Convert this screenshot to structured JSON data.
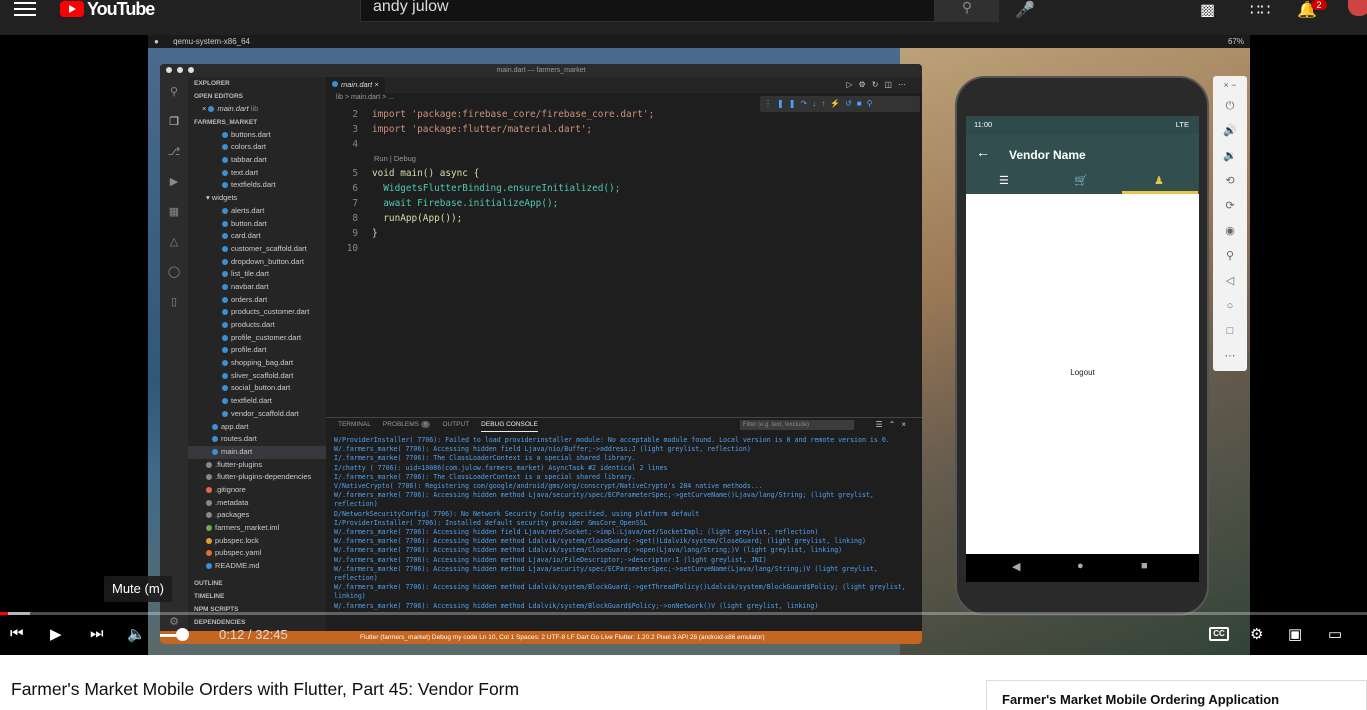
{
  "youtube": {
    "logo_text": "YouTube",
    "search_value": "andy julow",
    "notif_count": "2"
  },
  "mac": {
    "app_name": "qemu-system-x86_64",
    "battery": "67%"
  },
  "vscode": {
    "title": "main.dart — farmers_market",
    "explorer_label": "EXPLORER",
    "open_editors": "OPEN EDITORS",
    "open_file": "main.dart",
    "open_file_dir": "lib",
    "project": "FARMERS_MARKET",
    "files": [
      "buttons.dart",
      "colors.dart",
      "tabbar.dart",
      "text.dart",
      "textfields.dart"
    ],
    "widgets_folder": "widgets",
    "widget_files": [
      "alerts.dart",
      "button.dart",
      "card.dart",
      "customer_scaffold.dart",
      "dropdown_button.dart",
      "list_tile.dart",
      "navbar.dart",
      "orders.dart",
      "products_customer.dart",
      "products.dart",
      "profile_customer.dart",
      "profile.dart",
      "shopping_bag.dart",
      "sliver_scaffold.dart",
      "social_button.dart",
      "textfield.dart",
      "vendor_scaffold.dart"
    ],
    "root_files": [
      "app.dart",
      "routes.dart",
      "main.dart",
      ".flutter-plugins",
      ".flutter-plugins-dependencies",
      ".gitignore",
      ".metadata",
      ".packages",
      "farmers_market.iml",
      "pubspec.lock",
      "pubspec.yaml",
      "README.md"
    ],
    "outline": "OUTLINE",
    "timeline": "TIMELINE",
    "npm_scripts": "NPM SCRIPTS",
    "dependencies": "DEPENDENCIES",
    "tab_label": "main.dart",
    "breadcrumb": "lib > main.dart > ...",
    "codelens": "Run | Debug",
    "code_lines": [
      {
        "n": "2",
        "t": "import 'package:firebase_core/firebase_core.dart';"
      },
      {
        "n": "3",
        "t": "import 'package:flutter/material.dart';"
      },
      {
        "n": "4",
        "t": ""
      },
      {
        "n": "5",
        "t": "void main() async {"
      },
      {
        "n": "6",
        "t": "  WidgetsFlutterBinding.ensureInitialized();"
      },
      {
        "n": "7",
        "t": "  await Firebase.initializeApp();"
      },
      {
        "n": "8",
        "t": "  runApp(App());"
      },
      {
        "n": "9",
        "t": "}"
      },
      {
        "n": "10",
        "t": ""
      }
    ],
    "panel_tabs": [
      "TERMINAL",
      "PROBLEMS",
      "OUTPUT",
      "DEBUG CONSOLE"
    ],
    "problems_count": "6",
    "filter_placeholder": "Filter (e.g. text, !exclude)",
    "console_lines": [
      "W/ProviderInstaller( 7706): Failed to load providerinstaller module: No acceptable module found. Local version is 0 and remote version is 0.",
      "W/.farmers_marke( 7706): Accessing hidden field Ljava/nio/Buffer;->address:J (light greylist, reflection)",
      "I/.farmers_marke( 7706): The ClassLoaderContext is a special shared library.",
      "I/chatty  ( 7706): uid=10086(com.julow.farmers_market) AsyncTask #2 identical 2 lines",
      "I/.farmers_marke( 7706): The ClassLoaderContext is a special shared library.",
      "V/NativeCrypto( 7706): Registering com/google/android/gms/org/conscrypt/NativeCrypto's 284 native methods...",
      "W/.farmers_marke( 7706): Accessing hidden method Ljava/security/spec/ECParameterSpec;->getCurveName()Ljava/lang/String; (light greylist, reflection)",
      "D/NetworkSecurityConfig( 7706): No Network Security Config specified, using platform default",
      "I/ProviderInstaller( 7706): Installed default security provider GmsCore_OpenSSL",
      "W/.farmers_marke( 7706): Accessing hidden field Ljava/net/Socket;->impl:Ljava/net/SocketImpl; (light greylist, reflection)",
      "W/.farmers_marke( 7706): Accessing hidden method Ldalvik/system/CloseGuard;->get()Ldalvik/system/CloseGuard; (light greylist, linking)",
      "W/.farmers_marke( 7706): Accessing hidden method Ldalvik/system/CloseGuard;->open(Ljava/lang/String;)V (light greylist, linking)",
      "W/.farmers_marke( 7706): Accessing hidden method Ljava/io/FileDescriptor;->descriptor:I (light greylist, JNI)",
      "W/.farmers_marke( 7706): Accessing hidden method Ljava/security/spec/ECParameterSpec;->setCurveName(Ljava/lang/String;)V (light greylist, reflection)",
      "W/.farmers_marke( 7706): Accessing hidden method Ldalvik/system/BlockGuard;->getThreadPolicy()Ldalvik/system/BlockGuard$Policy; (light greylist, linking)",
      "W/.farmers_marke( 7706): Accessing hidden method Ldalvik/system/BlockGuard$Policy;->onNetwork()V (light greylist, linking)"
    ],
    "status": "Flutter (farmers_market)    Debug my code          Ln 10, Col 1   Spaces: 2   UTF-8   LF   Dart   Go Live   Flutter: 1.20.2   Pixel 3 API 28 (android-x86 emulator)"
  },
  "phone": {
    "time": "11:00",
    "signal": "LTE",
    "app_title": "Vendor Name",
    "logout": "Logout"
  },
  "player": {
    "mute_tooltip": "Mute (m)",
    "time_current": "0:12",
    "time_separator": " / ",
    "time_total": "32:45",
    "progress_fraction": 0.006,
    "cc_label": "CC"
  },
  "page": {
    "video_title": "Farmer's Market Mobile Orders with Flutter, Part 45: Vendor Form",
    "playlist_title": "Farmer's Market Mobile Ordering Application"
  }
}
